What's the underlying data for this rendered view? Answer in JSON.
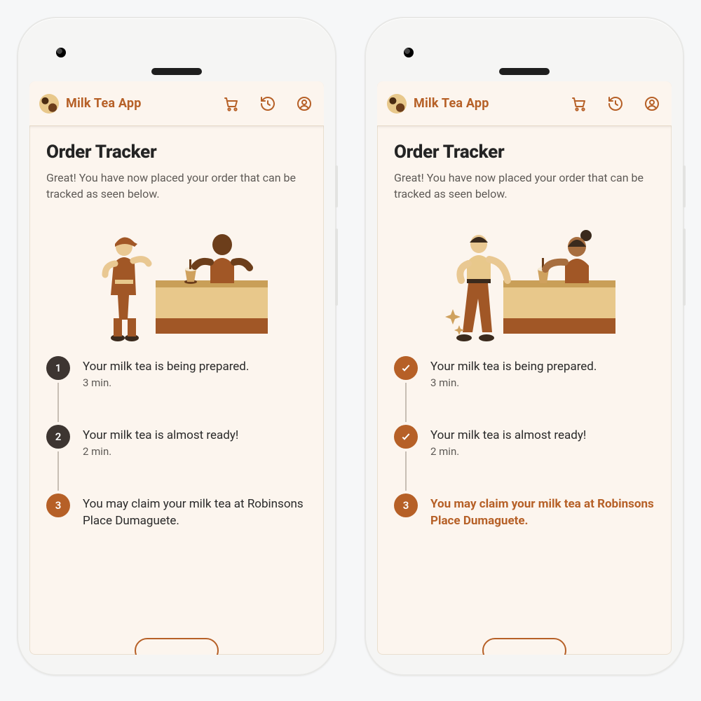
{
  "appbar": {
    "name": "Milk Tea App"
  },
  "page": {
    "title": "Order Tracker",
    "subtitle": "Great! You have now placed your order that can be tracked as seen below."
  },
  "steps": [
    {
      "num": "1",
      "title": "Your milk tea is being prepared.",
      "eta": "3 min."
    },
    {
      "num": "2",
      "title": "Your milk tea is almost ready!",
      "eta": "2 min."
    },
    {
      "num": "3",
      "title": "You may claim your milk tea at Robinsons Place Dumaguete.",
      "eta": ""
    }
  ],
  "icons": {
    "cart": "cart-icon",
    "history": "history-icon",
    "account": "account-icon"
  },
  "colors": {
    "accent": "#b66027",
    "stepDark": "#3d3531"
  }
}
